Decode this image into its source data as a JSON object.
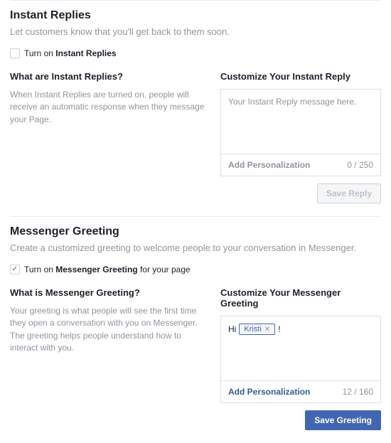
{
  "instant": {
    "title": "Instant Replies",
    "desc": "Let customers know that you'll get back to them soon.",
    "toggle_prefix": "Turn on ",
    "toggle_strong": "Instant Replies",
    "what_title": "What are Instant Replies?",
    "what_desc": "When Instant Replies are turned on, people will receive an automatic response when they message your Page.",
    "customize_title": "Customize Your Instant Reply",
    "placeholder": "Your Instant Reply message here.",
    "add_personalization": "Add Personalization",
    "char_count": "0 / 250",
    "save_label": "Save Reply"
  },
  "greeting": {
    "title": "Messenger Greeting",
    "desc": "Create a customized greeting to welcome people to your conversation in Messenger.",
    "toggle_prefix": "Turn on ",
    "toggle_strong": "Messenger Greeting",
    "toggle_suffix": " for your page",
    "what_title": "What is Messenger Greeting?",
    "what_desc": "Your greeting is what people will see the first time they open a conversation with you on Messenger. The greeting helps people understand how to interact with you.",
    "customize_title": "Customize Your Messenger Greeting",
    "greet_prefix": "Hi",
    "token_name": "Kristi",
    "greet_suffix": "!",
    "add_personalization": "Add Personalization",
    "char_count": "12 / 160",
    "save_label": "Save Greeting"
  }
}
